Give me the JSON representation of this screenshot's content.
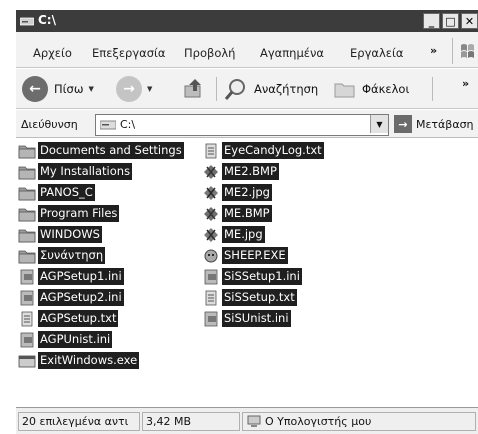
{
  "window": {
    "title": "C:\\",
    "buttons": {
      "minimize": "_",
      "maximize": "□",
      "close": "✕"
    }
  },
  "menu": {
    "items": [
      "Αρχείο",
      "Επεξεργασία",
      "Προβολή",
      "Αγαπημένα",
      "Εργαλεία"
    ],
    "more": "»"
  },
  "toolbar": {
    "back_label": "Πίσω",
    "search_label": "Αναζήτηση",
    "folders_label": "Φάκελοι",
    "more": "»"
  },
  "address": {
    "label": "Διεύθυνση",
    "value": "C:\\",
    "go_label": "Μετάβαση"
  },
  "files": {
    "column1": [
      {
        "name": "Documents and Settings",
        "icon": "folder-icon"
      },
      {
        "name": "My Installations",
        "icon": "folder-icon"
      },
      {
        "name": "PANOS_C",
        "icon": "folder-icon"
      },
      {
        "name": "Program Files",
        "icon": "folder-icon"
      },
      {
        "name": "WINDOWS",
        "icon": "folder-icon"
      },
      {
        "name": "Συνάντηση",
        "icon": "folder-icon"
      },
      {
        "name": "AGPSetup1.ini",
        "icon": "ini-file-icon"
      },
      {
        "name": "AGPSetup2.ini",
        "icon": "ini-file-icon"
      },
      {
        "name": "AGPSetup.txt",
        "icon": "text-file-icon"
      },
      {
        "name": "AGPUnist.ini",
        "icon": "ini-file-icon"
      },
      {
        "name": "ExitWindows.exe",
        "icon": "exe-icon"
      }
    ],
    "column2": [
      {
        "name": "EyeCandyLog.txt",
        "icon": "text-file-icon"
      },
      {
        "name": "ME2.BMP",
        "icon": "bitmap-image-icon"
      },
      {
        "name": "ME2.jpg",
        "icon": "jpeg-image-icon"
      },
      {
        "name": "ME.BMP",
        "icon": "bitmap-image-icon"
      },
      {
        "name": "ME.jpg",
        "icon": "jpeg-image-icon"
      },
      {
        "name": "SHEEP.EXE",
        "icon": "sheep-exe-icon"
      },
      {
        "name": "SiSSetup1.ini",
        "icon": "ini-file-icon"
      },
      {
        "name": "SiSSetup.txt",
        "icon": "text-file-icon"
      },
      {
        "name": "SiSUnist.ini",
        "icon": "ini-file-icon"
      }
    ]
  },
  "status": {
    "selection": "20 επιλεγμένα αντι",
    "size": "3,42 MB",
    "location": "Ο Υπολογιστής μου"
  }
}
